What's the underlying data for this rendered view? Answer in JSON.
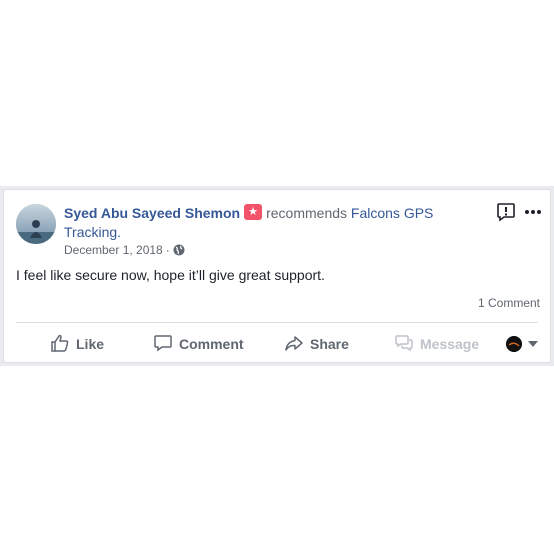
{
  "post": {
    "author": "Syed Abu Sayeed Shemon",
    "recommends_text": "recommends",
    "page_name": "Falcons GPS Tracking.",
    "date": "December 1, 2018",
    "separator": "·",
    "body": "I feel like secure now, hope it’ll give great support.",
    "comment_count": "1 Comment",
    "badge_icon": "star-icon"
  },
  "actions": {
    "like": "Like",
    "comment": "Comment",
    "share": "Share",
    "message": "Message"
  },
  "colors": {
    "link": "#365899",
    "badge": "#f35369",
    "secondary_text": "#616770",
    "disabled_text": "#bec3c9",
    "card_border": "#dddfe2",
    "page_bg": "#e9ebee"
  }
}
